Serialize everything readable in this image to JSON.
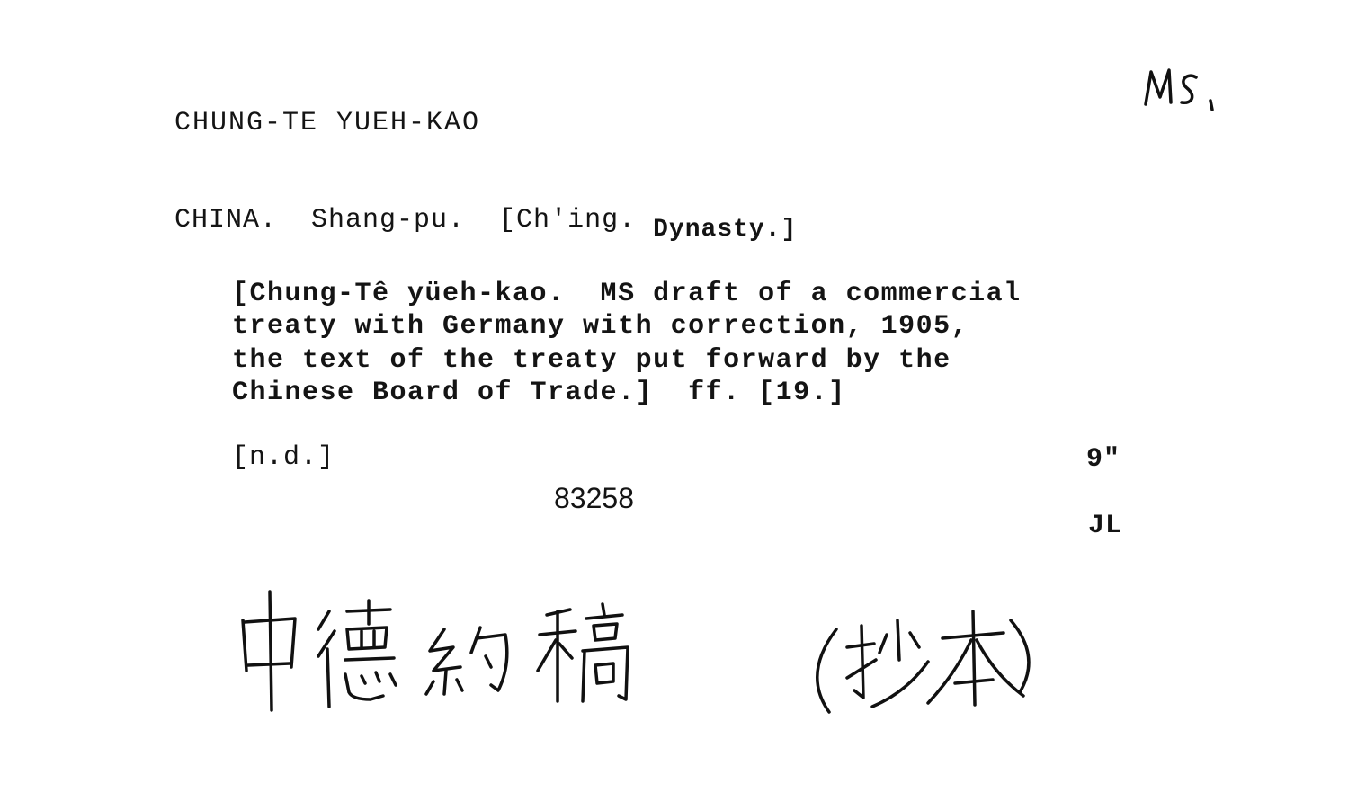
{
  "card": {
    "corner_note": "MS.",
    "heading": "CHUNG-TE YUEH-KAO",
    "entry": {
      "main": "CHINA.  Shang-pu.  [Ch'ing.",
      "dynasty": "Dynasty.]"
    },
    "description": [
      "[Chung-Tê yüeh-kao.  MS draft of a commercial",
      "treaty with Germany with correction, 1905,",
      "the text of the treaty put forward by the",
      "Chinese Board of Trade.]  ff. [19.]"
    ],
    "date": "[n.d.]",
    "size": "9\"",
    "accession_number": "83258",
    "initials": "JL",
    "chinese_title": "中德約稿 (抄本)"
  }
}
